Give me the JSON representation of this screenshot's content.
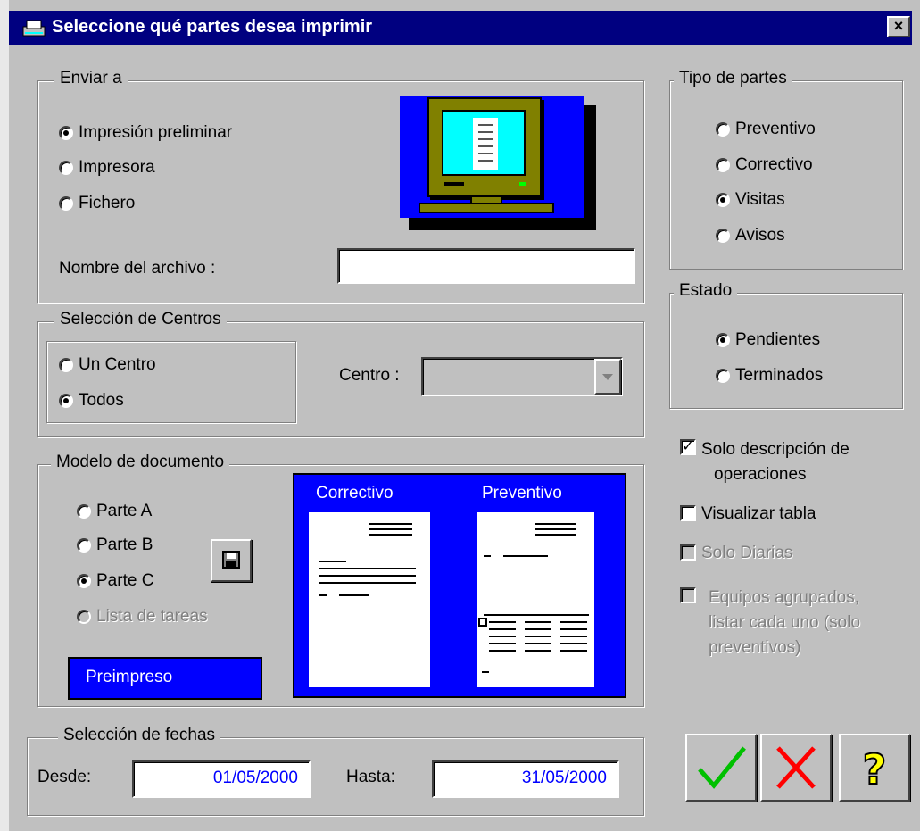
{
  "window": {
    "title": "Seleccione qué partes desea imprimir",
    "close_label": "×"
  },
  "enviar_a": {
    "legend": "Enviar a",
    "options": [
      "Impresión preliminar",
      "Impresora",
      "Fichero"
    ],
    "selected": "Impresión preliminar",
    "filename_label": "Nombre del archivo :",
    "filename_value": ""
  },
  "seleccion_centros": {
    "legend": "Selección de Centros",
    "options": [
      "Un Centro",
      "Todos"
    ],
    "selected": "Todos",
    "centro_label": "Centro :",
    "centro_value": ""
  },
  "modelo_documento": {
    "legend": "Modelo de documento",
    "options": [
      "Parte A",
      "Parte B",
      "Parte C",
      "Lista de tareas"
    ],
    "selected": "Parte C",
    "disabled": [
      "Lista de tareas"
    ],
    "preimpreso_label": "Preimpreso",
    "preview_labels": [
      "Correctivo",
      "Preventivo"
    ]
  },
  "seleccion_fechas": {
    "legend": "Selección de fechas",
    "desde_label": "Desde:",
    "desde_value": "01/05/2000",
    "hasta_label": "Hasta:",
    "hasta_value": "31/05/2000"
  },
  "tipo_partes": {
    "legend": "Tipo de partes",
    "options": [
      "Preventivo",
      "Correctivo",
      "Visitas",
      "Avisos"
    ],
    "selected": "Visitas"
  },
  "estado": {
    "legend": "Estado",
    "options": [
      "Pendientes",
      "Terminados"
    ],
    "selected": "Pendientes"
  },
  "checkboxes": [
    {
      "label": "Solo descripción de operaciones",
      "line1": "Solo descripción de",
      "line2": "operaciones",
      "checked": true,
      "enabled": true
    },
    {
      "label": "Visualizar tabla",
      "checked": false,
      "enabled": true
    },
    {
      "label": "Solo Diarias",
      "checked": false,
      "enabled": false
    },
    {
      "label": "Equipos agrupados, listar cada uno (solo preventivos)",
      "line1": "Equipos agrupados,",
      "line2": "listar cada uno (solo",
      "line3": "preventivos)",
      "checked": false,
      "enabled": false
    }
  ],
  "buttons": {
    "ok_icon": "checkmark-icon",
    "cancel_icon": "x-icon",
    "help_icon": "question-mark-icon",
    "save_icon": "floppy-disk-icon"
  },
  "colors": {
    "titlebar": "#000080",
    "preview_bg": "#0000ff",
    "date_text": "#0000ff",
    "ok_green": "#00c000",
    "cancel_red": "#ff0000",
    "help_yellow": "#ffff00"
  }
}
